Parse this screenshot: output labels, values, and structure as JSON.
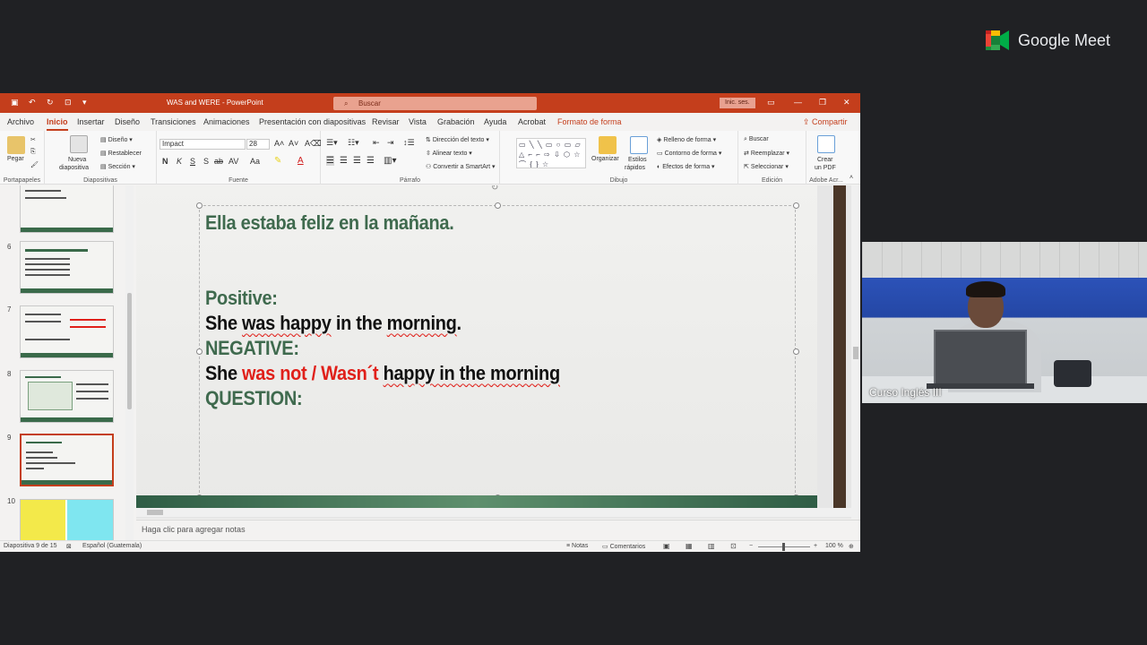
{
  "meet": {
    "brand": "Google Meet"
  },
  "titlebar": {
    "doc_title": "WAS and WERE  -  PowerPoint",
    "search_placeholder": "Buscar",
    "signin": "Inic. ses."
  },
  "menu": {
    "tabs": [
      "Archivo",
      "Inicio",
      "Insertar",
      "Diseño",
      "Transiciones",
      "Animaciones",
      "Presentación con diapositivas",
      "Revisar",
      "Vista",
      "Grabación",
      "Ayuda",
      "Acrobat",
      "Formato de forma"
    ],
    "share": "Compartir"
  },
  "ribbon": {
    "clipboard": {
      "paste": "Pegar",
      "label": "Portapapeles"
    },
    "slides": {
      "new_slide_1": "Nueva",
      "new_slide_2": "diapositiva",
      "layout": "Diseño",
      "reset": "Restablecer",
      "section": "Sección",
      "label": "Diapositivas"
    },
    "font": {
      "name": "Impact",
      "size": "28",
      "bold": "N",
      "italic": "K",
      "underline": "S",
      "strike": "S",
      "spacing": "AV",
      "case": "Aa",
      "label": "Fuente"
    },
    "paragraph": {
      "text_direction": "Dirección del texto",
      "align_text": "Alinear texto",
      "smartart": "Convertir a SmartArt",
      "label": "Párrafo"
    },
    "drawing": {
      "shapes": "▭ ╲ ╲ ▭ ○ ▭ ▱ △ ⌐ ⌐ ⇨ ⇩ ⬡ ☆ ⌒ { } ☆",
      "arrange": "Organizar",
      "quick_styles_1": "Estilos",
      "quick_styles_2": "rápidos",
      "fill": "Relleno de forma",
      "outline": "Contorno de forma",
      "effects": "Efectos de forma",
      "label": "Dibujo"
    },
    "editing": {
      "find": "Buscar",
      "replace": "Reemplazar",
      "select": "Seleccionar",
      "label": "Edición"
    },
    "adobe": {
      "create_pdf_1": "Crear",
      "create_pdf_2": "un PDF",
      "label": "Adobe Acr..."
    }
  },
  "thumbnails": [
    {
      "num": "",
      "caption": ""
    },
    {
      "num": "6",
      "caption": ""
    },
    {
      "num": "7",
      "caption": ""
    },
    {
      "num": "8",
      "caption": ""
    },
    {
      "num": "9",
      "caption": ""
    },
    {
      "num": "10",
      "caption": ""
    }
  ],
  "slide": {
    "title": "Ella estaba feliz en la mañana.",
    "positive_label": "Positive:",
    "positive_sentence_a": "She ",
    "positive_sentence_b": "was happy",
    "positive_sentence_c": " in the ",
    "positive_sentence_d": "morning",
    "positive_sentence_e": ".",
    "negative_label": "NEGATIVE:",
    "negative_sentence_a": "She ",
    "negative_sentence_red": "was not / Wasn´t",
    "negative_sentence_b": " ",
    "negative_sentence_c": "happy in the morning",
    "question_label": "QUESTION:"
  },
  "notes": {
    "placeholder": "Haga clic para agregar notas"
  },
  "status": {
    "slide_count": "Diapositiva 9 de 15",
    "language": "Español (Guatemala)",
    "notes": "Notas",
    "comments": "Comentarios",
    "zoom": "100 %"
  },
  "participant": {
    "name": "Curso Inglés III"
  },
  "colors": {
    "ppt_accent": "#c43e1c",
    "slide_green": "#3f6a4e",
    "slide_red": "#e0201a"
  }
}
